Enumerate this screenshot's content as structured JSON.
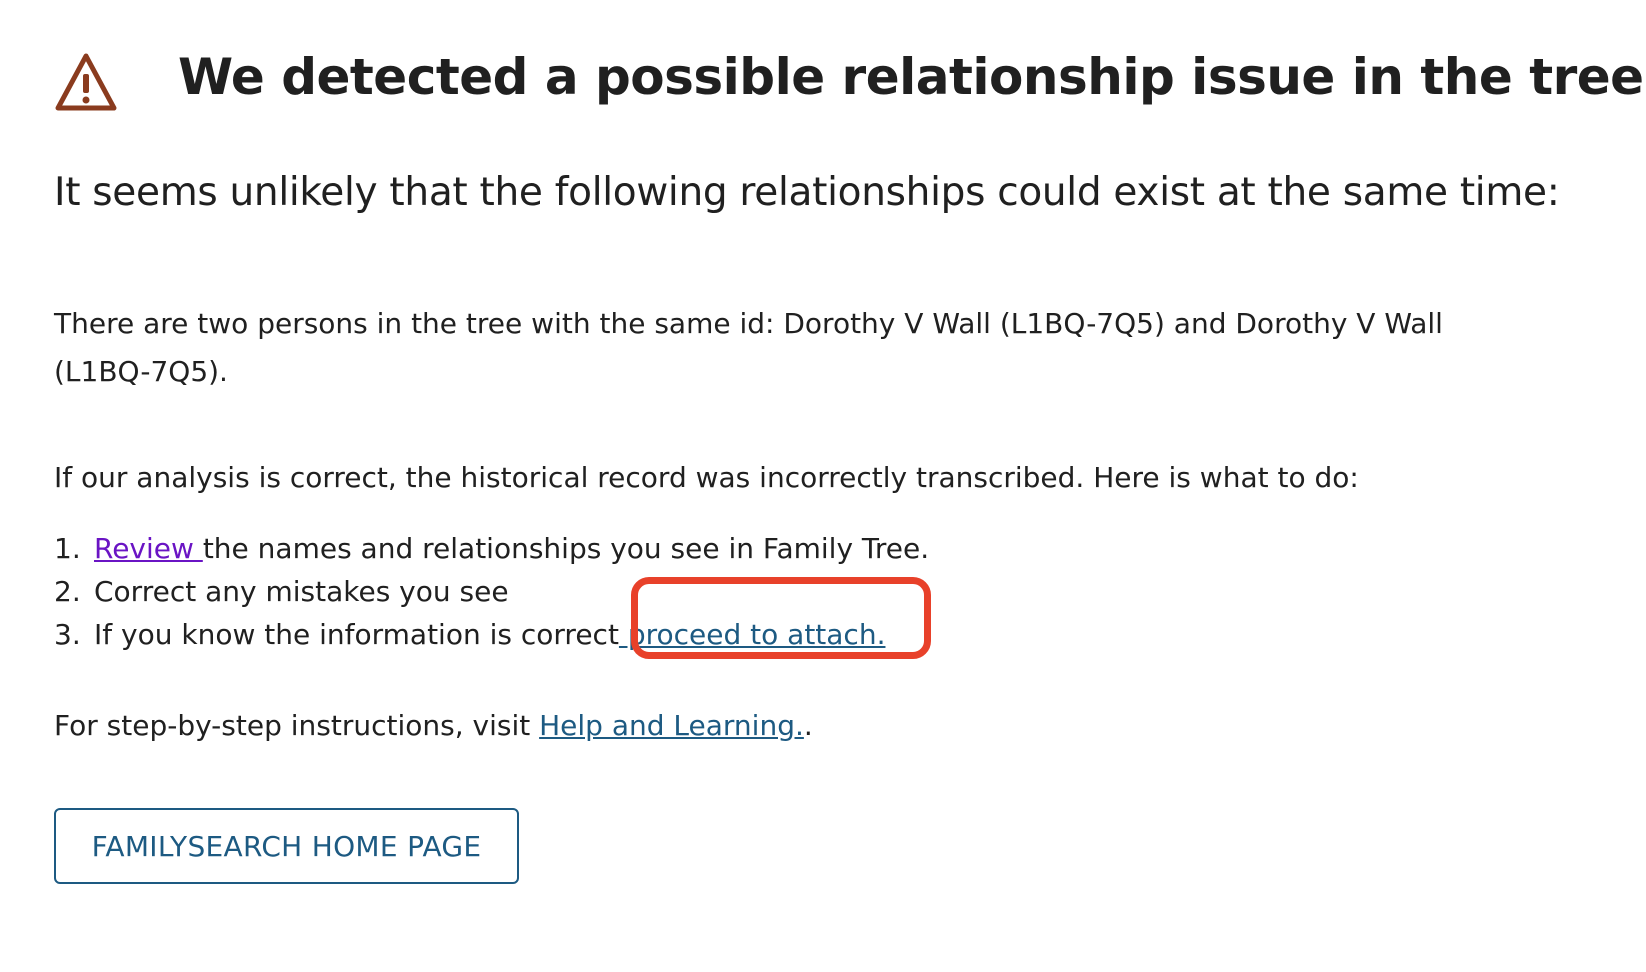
{
  "header": {
    "icon": "warning-triangle-icon",
    "title": "We detected a possible relationship issue in the tree."
  },
  "subtitle": "It seems unlikely that the following relationships could exist at the same time:",
  "issue": {
    "text": "There are two persons in the tree with the same id: Dorothy V Wall (L1BQ-7Q5) and Dorothy V Wall (L1BQ-7Q5)."
  },
  "analysis": {
    "text": "If our analysis is correct, the historical record was incorrectly transcribed. Here is what to do:"
  },
  "steps": [
    {
      "number": "1.",
      "link_label": "Review ",
      "text": "the names and relationships you see in Family Tree."
    },
    {
      "number": "2.",
      "text": "Correct any mistakes you see"
    },
    {
      "number": "3.",
      "text": "If you know the information is correct",
      "link_label": " proceed to attach."
    }
  ],
  "help": {
    "prefix": "For step-by-step instructions, visit ",
    "link_label": "Help and Learning.",
    "suffix": "."
  },
  "home_button": {
    "label": "FAMILYSEARCH HOME PAGE"
  },
  "colors": {
    "warning_icon": "#8a3b1e",
    "link_visited": "#6a14c4",
    "link": "#1d5a82",
    "highlight": "#e8412a",
    "text": "#202020"
  }
}
